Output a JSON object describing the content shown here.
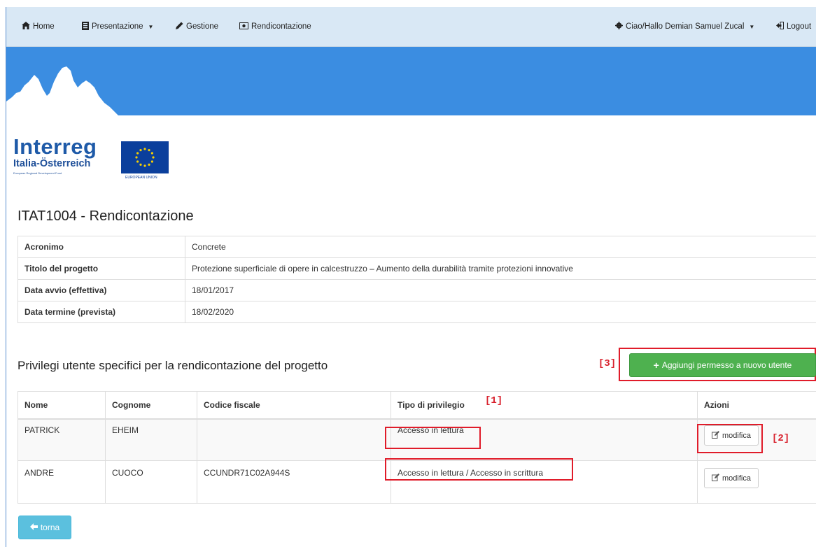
{
  "navbar": {
    "home": {
      "label": "Home",
      "icon": "home-icon"
    },
    "presentazione": {
      "label": "Presentazione",
      "icon": "list-icon"
    },
    "gestione": {
      "label": "Gestione",
      "icon": "pencil-icon"
    },
    "rendicontazione": {
      "label": "Rendicontazione",
      "icon": "money-icon"
    },
    "user": {
      "label": "Ciao/Hallo Demian Samuel Zucal",
      "icon": "gear-icon"
    },
    "logout": {
      "label": "Logout",
      "icon": "logout-icon"
    }
  },
  "logo": {
    "title": "Interreg",
    "subtitle": "Italia-Österreich",
    "tagline": "European Regional Development Fund",
    "eu_label": "EUROPEAN UNION"
  },
  "page_title": "ITAT1004 - Rendicontazione",
  "info": [
    {
      "label": "Acronimo",
      "value": "Concrete"
    },
    {
      "label": "Titolo del progetto",
      "value": "Protezione superficiale di opere in calcestruzzo – Aumento della durabilità tramite protezioni innovative"
    },
    {
      "label": "Data avvio (effettiva)",
      "value": "18/01/2017"
    },
    {
      "label": "Data termine (prevista)",
      "value": "18/02/2020"
    }
  ],
  "privileges": {
    "title": "Privilegi utente specifici per la rendicontazione del progetto",
    "add_button": "Aggiungi permesso a nuovo utente",
    "headers": [
      "Nome",
      "Cognome",
      "Codice fiscale",
      "Tipo di privilegio",
      "Azioni"
    ],
    "rows": [
      {
        "nome": "PATRICK",
        "cognome": "EHEIM",
        "codice_fiscale": "",
        "tipo": "Accesso in lettura",
        "action": "modifica"
      },
      {
        "nome": "ANDRE",
        "cognome": "CUOCO",
        "codice_fiscale": "CCUNDR71C02A944S",
        "tipo": "Accesso in lettura / Accesso in scrittura",
        "action": "modifica"
      }
    ]
  },
  "annotations": {
    "one": "[1]",
    "two": "[2]",
    "three": "[3]"
  },
  "back_button": "torna",
  "colors": {
    "navbar_bg": "#d9e8f5",
    "banner_bg": "#3b8de1",
    "add_button": "#4eb14f",
    "back_button": "#5bc0de",
    "callout": "#e01c2a"
  }
}
